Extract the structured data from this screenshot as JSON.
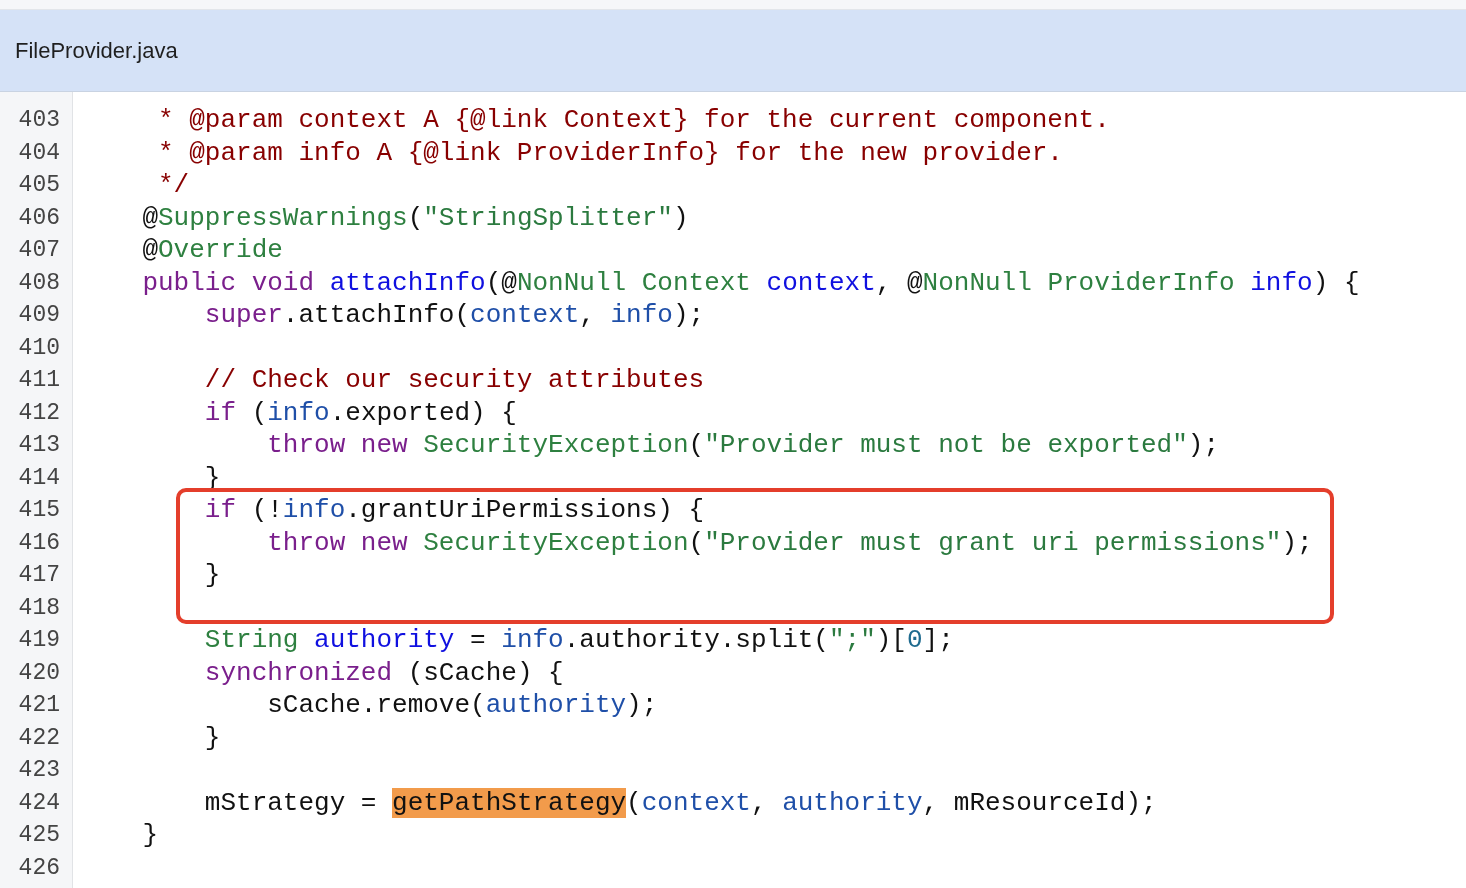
{
  "file_header": {
    "title": "FileProvider.java"
  },
  "code_lines": [
    {
      "number": "403",
      "tokens": [
        {
          "kind": "comment",
          "text": "     * @param context A {@link Context} for the current component."
        }
      ]
    },
    {
      "number": "404",
      "tokens": [
        {
          "kind": "comment",
          "text": "     * @param info A {@link ProviderInfo} for the new provider."
        }
      ]
    },
    {
      "number": "405",
      "tokens": [
        {
          "kind": "comment",
          "text": "     */"
        }
      ]
    },
    {
      "number": "406",
      "tokens": [
        {
          "kind": "plain",
          "text": "    @"
        },
        {
          "kind": "annotation",
          "text": "SuppressWarnings"
        },
        {
          "kind": "plain",
          "text": "("
        },
        {
          "kind": "string",
          "text": "\"StringSplitter\""
        },
        {
          "kind": "plain",
          "text": ")"
        }
      ]
    },
    {
      "number": "407",
      "tokens": [
        {
          "kind": "plain",
          "text": "    @"
        },
        {
          "kind": "annotation",
          "text": "Override"
        }
      ]
    },
    {
      "number": "408",
      "tokens": [
        {
          "kind": "keyword",
          "text": "    public void"
        },
        {
          "kind": "declaration",
          "text": " attachInfo"
        },
        {
          "kind": "plain",
          "text": "(@"
        },
        {
          "kind": "annotation",
          "text": "NonNull"
        },
        {
          "kind": "type",
          "text": " Context"
        },
        {
          "kind": "declaration",
          "text": " context"
        },
        {
          "kind": "plain",
          "text": ", @"
        },
        {
          "kind": "annotation",
          "text": "NonNull"
        },
        {
          "kind": "type",
          "text": " ProviderInfo"
        },
        {
          "kind": "declaration",
          "text": " info"
        },
        {
          "kind": "plain",
          "text": ") {"
        }
      ]
    },
    {
      "number": "409",
      "tokens": [
        {
          "kind": "keyword",
          "text": "        super"
        },
        {
          "kind": "plain",
          "text": ".attachInfo("
        },
        {
          "kind": "reference",
          "text": "context"
        },
        {
          "kind": "plain",
          "text": ", "
        },
        {
          "kind": "reference",
          "text": "info"
        },
        {
          "kind": "plain",
          "text": ");"
        }
      ]
    },
    {
      "number": "410"
    },
    {
      "number": "411",
      "tokens": [
        {
          "kind": "comment",
          "text": "        // Check our security attributes"
        }
      ]
    },
    {
      "number": "412",
      "tokens": [
        {
          "kind": "keyword",
          "text": "        if"
        },
        {
          "kind": "plain",
          "text": " ("
        },
        {
          "kind": "reference",
          "text": "info"
        },
        {
          "kind": "plain",
          "text": ".exported) {"
        }
      ]
    },
    {
      "number": "413",
      "tokens": [
        {
          "kind": "keyword",
          "text": "            throw new"
        },
        {
          "kind": "type",
          "text": " SecurityException"
        },
        {
          "kind": "plain",
          "text": "("
        },
        {
          "kind": "string",
          "text": "\"Provider must not be exported\""
        },
        {
          "kind": "plain",
          "text": ");"
        }
      ]
    },
    {
      "number": "414",
      "tokens": [
        {
          "kind": "plain",
          "text": "        }"
        }
      ]
    },
    {
      "number": "415",
      "boxed": true,
      "tokens": [
        {
          "kind": "keyword",
          "text": "        if"
        },
        {
          "kind": "plain",
          "text": " (!"
        },
        {
          "kind": "reference",
          "text": "info"
        },
        {
          "kind": "plain",
          "text": ".grantUriPermissions) {"
        }
      ]
    },
    {
      "number": "416",
      "boxed": true,
      "tokens": [
        {
          "kind": "keyword",
          "text": "            throw new"
        },
        {
          "kind": "type",
          "text": " SecurityException"
        },
        {
          "kind": "plain",
          "text": "("
        },
        {
          "kind": "string",
          "text": "\"Provider must grant uri permissions\""
        },
        {
          "kind": "plain",
          "text": ");"
        }
      ]
    },
    {
      "number": "417",
      "boxed": true,
      "tokens": [
        {
          "kind": "plain",
          "text": "        }"
        }
      ]
    },
    {
      "number": "418",
      "boxed": true
    },
    {
      "number": "419",
      "tokens": [
        {
          "kind": "type",
          "text": "        String"
        },
        {
          "kind": "declaration",
          "text": " authority"
        },
        {
          "kind": "plain",
          "text": " = "
        },
        {
          "kind": "reference",
          "text": "info"
        },
        {
          "kind": "plain",
          "text": ".authority.split("
        },
        {
          "kind": "string",
          "text": "\";\""
        },
        {
          "kind": "plain",
          "text": ")["
        },
        {
          "kind": "number",
          "text": "0"
        },
        {
          "kind": "plain",
          "text": "];"
        }
      ]
    },
    {
      "number": "420",
      "tokens": [
        {
          "kind": "keyword",
          "text": "        synchronized"
        },
        {
          "kind": "plain",
          "text": " (sCache) {"
        }
      ]
    },
    {
      "number": "421",
      "tokens": [
        {
          "kind": "plain",
          "text": "            sCache.remove("
        },
        {
          "kind": "reference",
          "text": "authority"
        },
        {
          "kind": "plain",
          "text": ");"
        }
      ]
    },
    {
      "number": "422",
      "tokens": [
        {
          "kind": "plain",
          "text": "        }"
        }
      ]
    },
    {
      "number": "423"
    },
    {
      "number": "424",
      "tokens": [
        {
          "kind": "plain",
          "text": "        mStrategy = "
        },
        {
          "kind": "highlight",
          "text": "getPathStrategy"
        },
        {
          "kind": "plain",
          "text": "("
        },
        {
          "kind": "reference",
          "text": "context"
        },
        {
          "kind": "plain",
          "text": ", "
        },
        {
          "kind": "reference",
          "text": "authority"
        },
        {
          "kind": "plain",
          "text": ", mResourceId);"
        }
      ]
    },
    {
      "number": "425",
      "tokens": [
        {
          "kind": "plain",
          "text": "    }"
        }
      ]
    },
    {
      "number": "426"
    }
  ]
}
